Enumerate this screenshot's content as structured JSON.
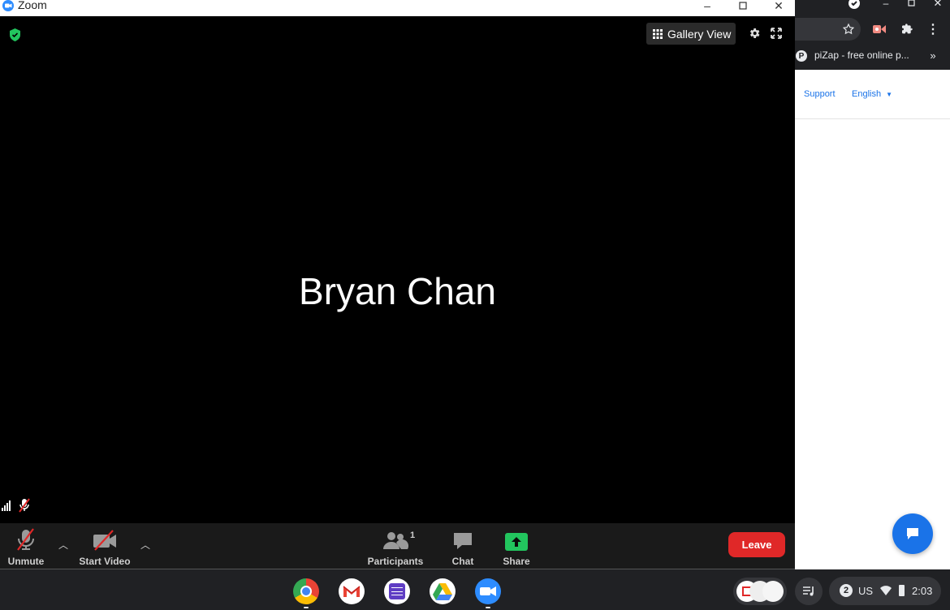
{
  "zoom": {
    "window_title": "Zoom",
    "gallery_view_label": "Gallery View",
    "participant_name": "Bryan Chan",
    "toolbar": {
      "unmute_label": "Unmute",
      "start_video_label": "Start Video",
      "participants_label": "Participants",
      "participants_count": "1",
      "chat_label": "Chat",
      "share_label": "Share",
      "leave_label": "Leave"
    },
    "colors": {
      "leave": "#e02828",
      "share": "#22c55e",
      "shield": "#22c55e",
      "accent": "#2d8cff"
    }
  },
  "chrome": {
    "bookmark_label": "piZap - free online p...",
    "support_link": "Support",
    "english_link": "English",
    "accent": "#1a73e8"
  },
  "shelf": {
    "apps": [
      "chrome-icon",
      "gmail-icon",
      "tasks-icon",
      "drive-icon",
      "zoom-icon"
    ],
    "tray": {
      "notification_count": "2",
      "input_method": "US",
      "time": "2:03"
    }
  }
}
